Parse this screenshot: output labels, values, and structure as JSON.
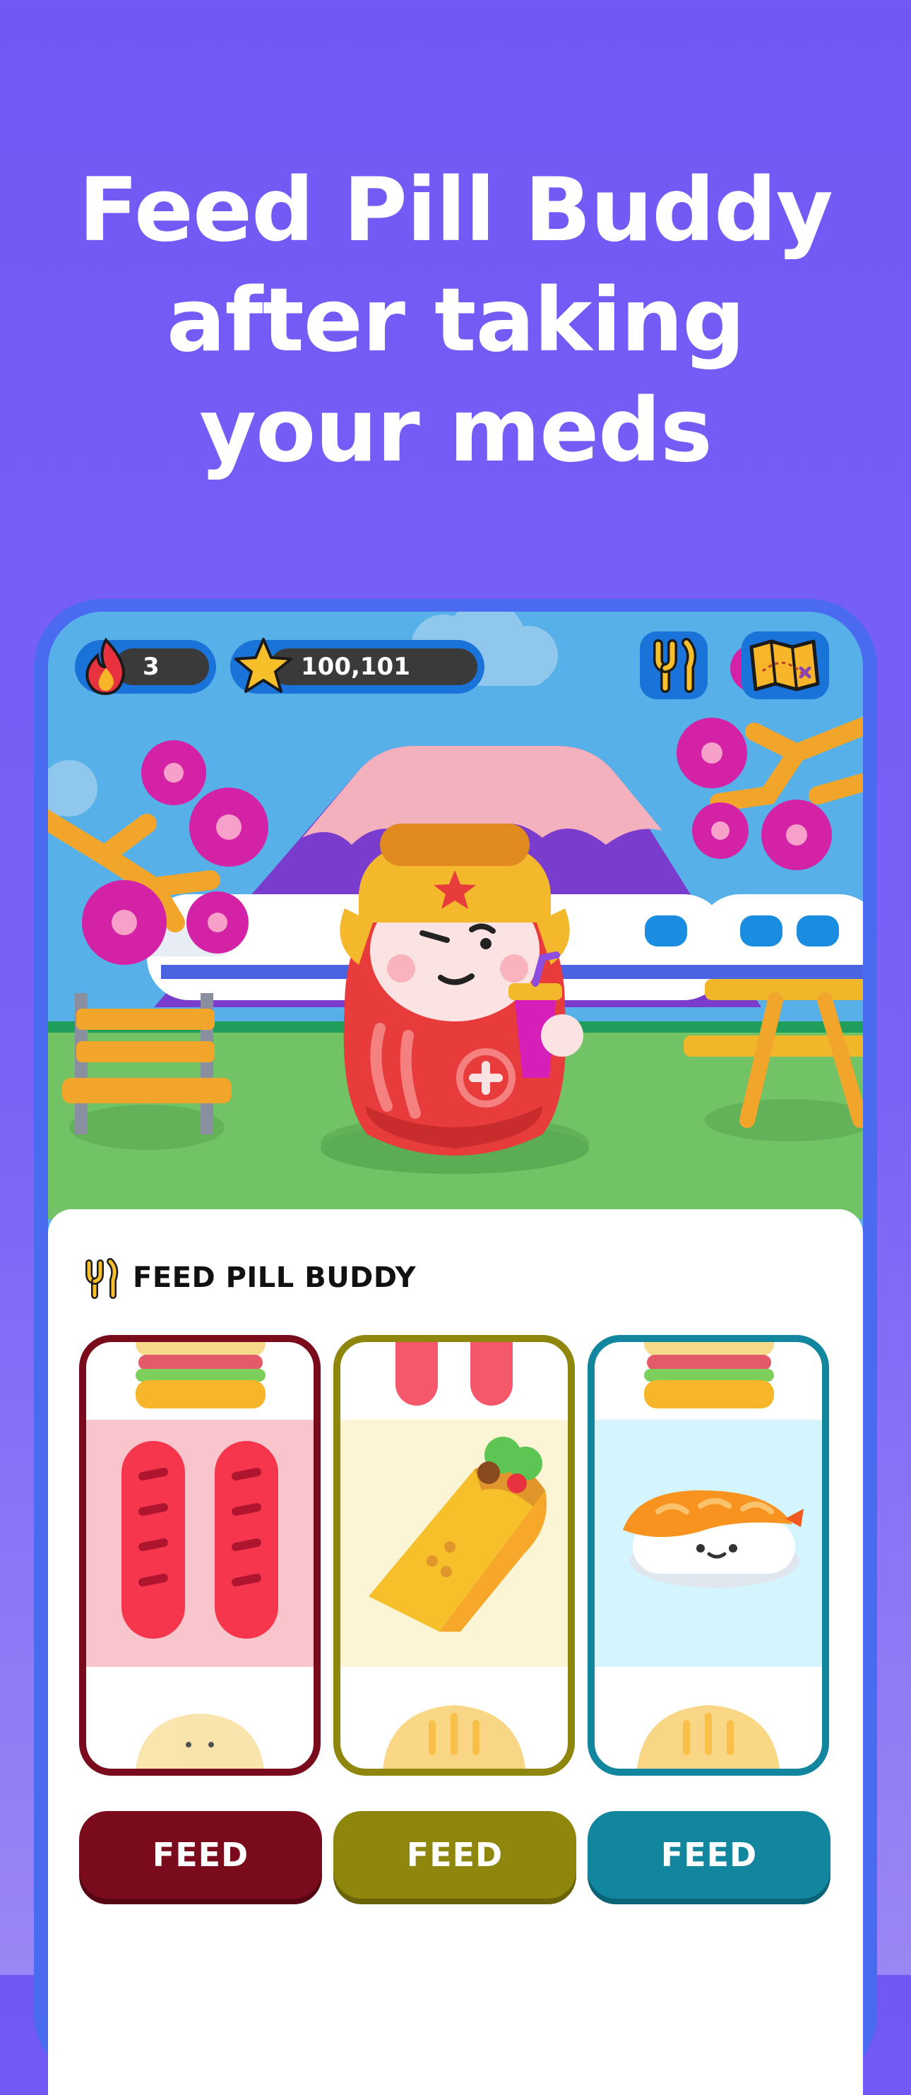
{
  "headline": {
    "line1": "Feed Pill Buddy",
    "line2": "after taking",
    "line3": "your meds"
  },
  "hud": {
    "streak": "3",
    "stars": "100,101",
    "icons": [
      "fire-icon",
      "star-icon",
      "utensils-icon",
      "treasure-map-icon"
    ]
  },
  "panel": {
    "title": "FEED PILL BUDDY",
    "title_icon": "utensils-icon"
  },
  "reels": [
    {
      "food": "sausages",
      "top": "sandwich",
      "bottom": "dumpling",
      "color": "#7a0b1c",
      "bg": "#f8c5cd"
    },
    {
      "food": "burrito",
      "top": "sausages",
      "bottom": "dumpling",
      "color": "#8f860e",
      "bg": "#fbf5d6"
    },
    {
      "food": "sushi",
      "top": "sandwich",
      "bottom": "dumpling",
      "color": "#12869f",
      "bg": "#d4f5fd"
    }
  ],
  "buttons": [
    {
      "label": "FEED",
      "color": "#7a0b1c"
    },
    {
      "label": "FEED",
      "color": "#8f860e"
    },
    {
      "label": "FEED",
      "color": "#12869f"
    }
  ],
  "colors": {
    "background": "#7158f5",
    "frame": "#4a6af0",
    "hud_blue": "#1a73d8"
  }
}
